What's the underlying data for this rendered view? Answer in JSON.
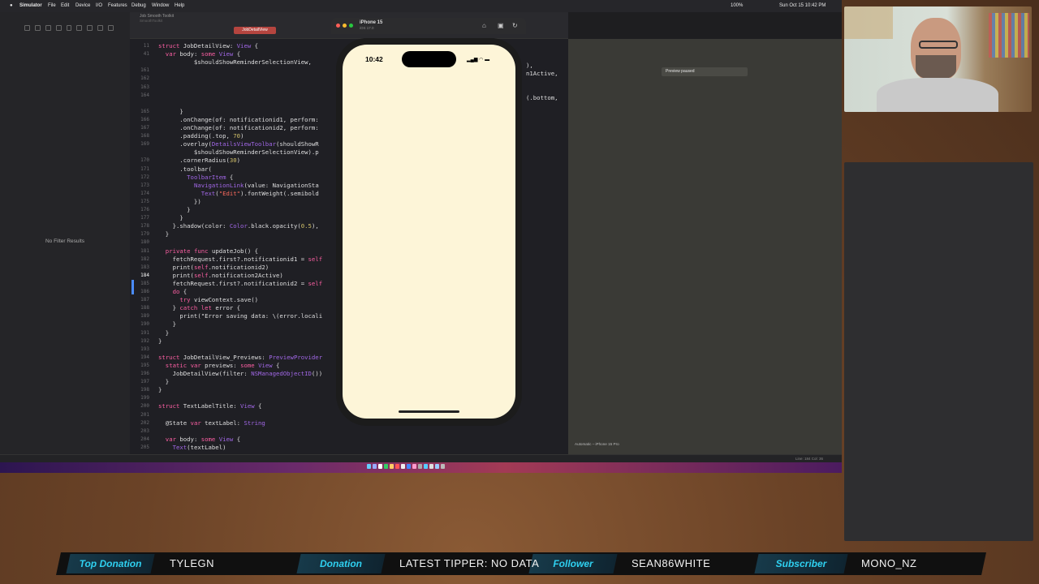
{
  "menubar": {
    "app": "Simulator",
    "items": [
      "File",
      "Edit",
      "Device",
      "I/O",
      "Features",
      "Debug",
      "Window",
      "Help"
    ],
    "battery": "100%",
    "datetime": "Sun Oct 15  10:42 PM"
  },
  "navigator": {
    "no_filter": "No Filter Results"
  },
  "editor": {
    "project_title": "Job Smooth Toolkit",
    "project_subtitle": "SmoothToolkit",
    "active_tab": "JobDetailView",
    "lines": [
      {
        "n": "11",
        "code": "struct JobDetailView: View {"
      },
      {
        "n": "41",
        "code": "  var body: some View {"
      },
      {
        "n": "",
        "code": "          $shouldShowReminderSelectionView,"
      },
      {
        "n": "161",
        "code": ""
      },
      {
        "n": "162",
        "code": ""
      },
      {
        "n": "163",
        "code": ""
      },
      {
        "n": "164",
        "code": ""
      },
      {
        "n": "",
        "code": ""
      },
      {
        "n": "165",
        "code": "      }"
      },
      {
        "n": "166",
        "code": "      .onChange(of: notificationid1, perform:"
      },
      {
        "n": "167",
        "code": "      .onChange(of: notificationid2, perform:"
      },
      {
        "n": "168",
        "code": "      .padding(.top, 70)"
      },
      {
        "n": "169",
        "code": "      .overlay(DetailsViewToolbar(shouldShowR"
      },
      {
        "n": "",
        "code": "          $shouldShowReminderSelectionView).p"
      },
      {
        "n": "170",
        "code": "      .cornerRadius(30)"
      },
      {
        "n": "171",
        "code": "      .toolbar("
      },
      {
        "n": "172",
        "code": "        ToolbarItem {"
      },
      {
        "n": "173",
        "code": "          NavigationLink(value: NavigationSta"
      },
      {
        "n": "174",
        "code": "            Text(\"Edit\").fontWeight(.semibold"
      },
      {
        "n": "175",
        "code": "          })"
      },
      {
        "n": "176",
        "code": "        }"
      },
      {
        "n": "177",
        "code": "      }"
      },
      {
        "n": "178",
        "code": "    }.shadow(color: Color.black.opacity(0.5),"
      },
      {
        "n": "179",
        "code": "  }"
      },
      {
        "n": "180",
        "code": ""
      },
      {
        "n": "181",
        "code": "  private func updateJob() {"
      },
      {
        "n": "182",
        "code": "    fetchRequest.first?.notificationid1 = self"
      },
      {
        "n": "183",
        "code": "    print(self.notificationid2)"
      },
      {
        "n": "184",
        "code": "    print(self.notification2Active)"
      },
      {
        "n": "185",
        "code": "    fetchRequest.first?.notificationid2 = self"
      },
      {
        "n": "186",
        "code": "    do {"
      },
      {
        "n": "187",
        "code": "      try viewContext.save()"
      },
      {
        "n": "188",
        "code": "    } catch let error {"
      },
      {
        "n": "189",
        "code": "      print(\"Error saving data: \\(error.locali"
      },
      {
        "n": "190",
        "code": "    }"
      },
      {
        "n": "191",
        "code": "  }"
      },
      {
        "n": "192",
        "code": "}"
      },
      {
        "n": "193",
        "code": ""
      },
      {
        "n": "194",
        "code": "struct JobDetailView_Previews: PreviewProvider"
      },
      {
        "n": "195",
        "code": "  static var previews: some View {"
      },
      {
        "n": "196",
        "code": "    JobDetailView(filter: NSManagedObjectID())"
      },
      {
        "n": "197",
        "code": "  }"
      },
      {
        "n": "198",
        "code": "}"
      },
      {
        "n": "199",
        "code": ""
      },
      {
        "n": "200",
        "code": "struct TextLabelTitle: View {"
      },
      {
        "n": "201",
        "code": ""
      },
      {
        "n": "202",
        "code": "  @State var textLabel: String"
      },
      {
        "n": "203",
        "code": ""
      },
      {
        "n": "204",
        "code": "  var body: some View {"
      },
      {
        "n": "205",
        "code": "    Text(textLabel)"
      }
    ],
    "right_fragments": [
      "),",
      "n1Active,",
      "(.bottom,"
    ],
    "current_line": "184"
  },
  "canvas": {
    "preview_paused": "Preview paused",
    "device_picker": "Automatic – iPhone 15 Pro"
  },
  "statusbar": {
    "position": "Line: 184  Col: 36"
  },
  "simulator": {
    "device": "iPhone 15",
    "os": "iOS 17.0",
    "time": "10:42"
  },
  "ticker": {
    "top_donation_label": "Top Donation",
    "top_donation_value": "TYLEGN",
    "donation_label": "Donation",
    "donation_value": "LATEST TIPPER: NO DATA",
    "follower_label": "Follower",
    "follower_value": "SEAN86WHITE",
    "subscriber_label": "Subscriber",
    "subscriber_value": "MONO_NZ"
  },
  "colors": {
    "accent_cyan": "#2fd0f0",
    "tab_red": "#b5453f",
    "phone_screen": "#fdf5d8"
  }
}
